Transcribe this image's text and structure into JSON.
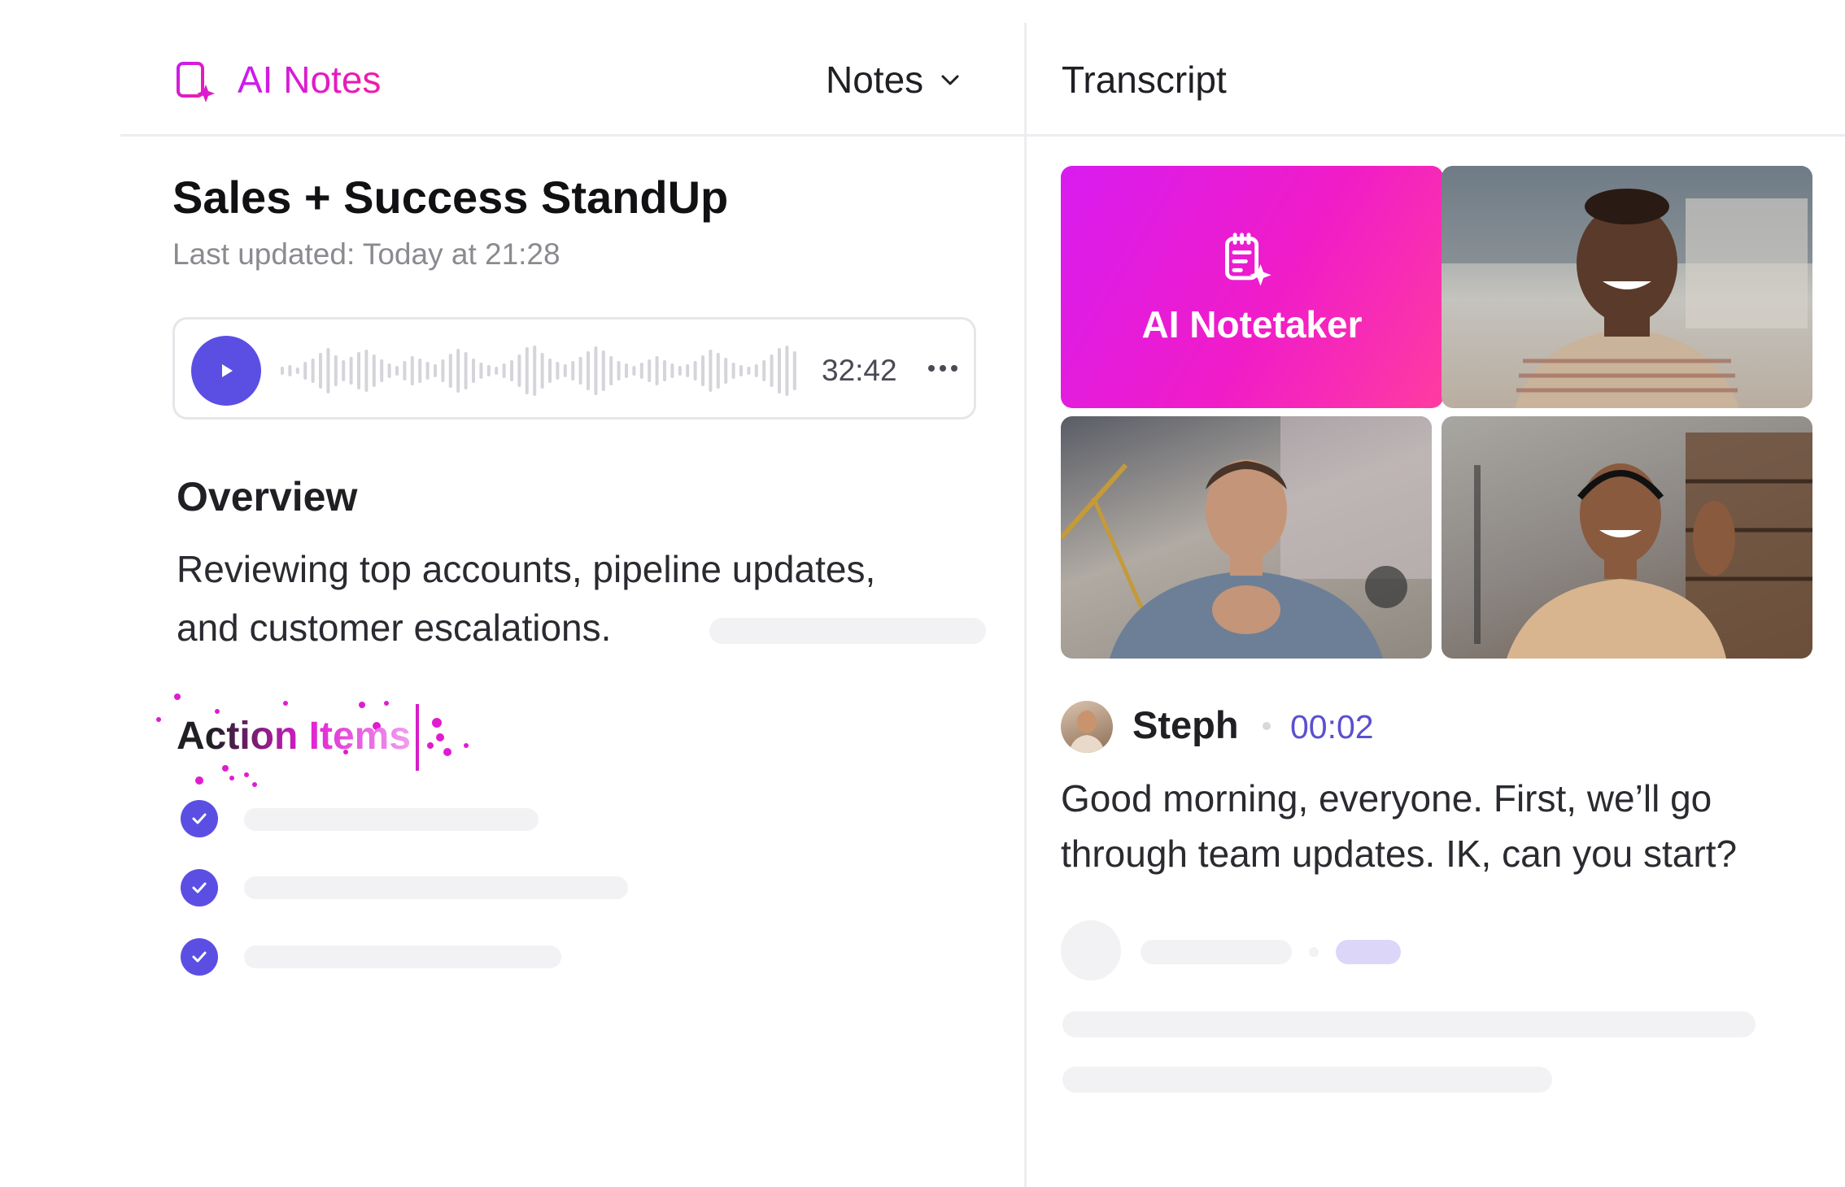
{
  "header": {
    "brand_title": "AI Notes",
    "brand_icon": "notes-sparkle-icon",
    "notes_dropdown_label": "Notes",
    "transcript_title": "Transcript"
  },
  "note": {
    "title": "Sales + Success StandUp",
    "last_updated": "Last updated: Today at 21:28"
  },
  "player": {
    "duration": "32:42"
  },
  "overview": {
    "heading": "Overview",
    "line1": "Reviewing top accounts, pipeline updates,",
    "line2": "and customer escalations."
  },
  "action_items": {
    "heading": "Action Items",
    "count": 3
  },
  "meeting": {
    "notetaker_label": "AI Notetaker"
  },
  "transcript": {
    "speaker": "Steph",
    "timestamp": "00:02",
    "line1": "Good morning, everyone. First, we’ll go",
    "line2": "through team updates. IK, can you start?"
  },
  "colors": {
    "accent_purple": "#5b4fe3",
    "brand_pink": "#e01cd0",
    "timestamp_purple": "#5b4fd0"
  }
}
